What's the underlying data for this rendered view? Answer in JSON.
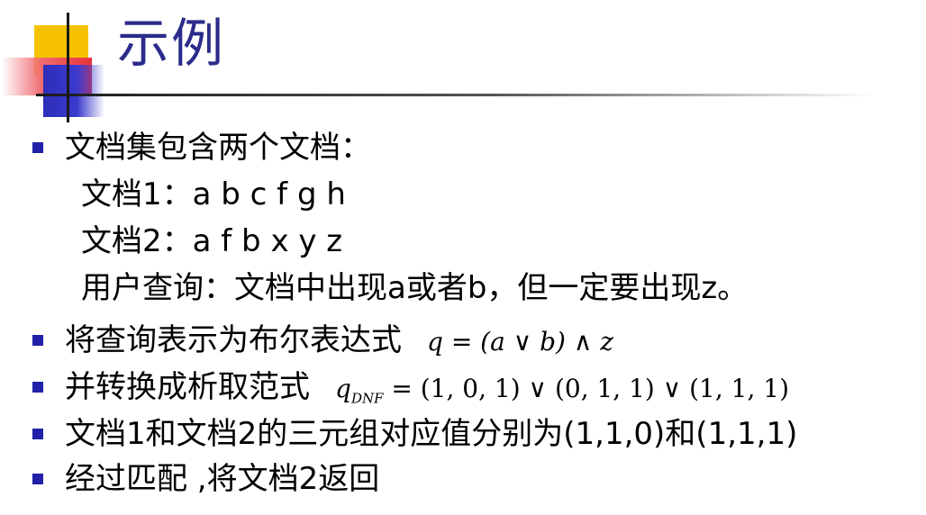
{
  "title": "示例",
  "bullets": [
    "文档集包含两个文档：",
    "将查询表示为布尔表达式",
    "并转换成析取范式",
    "文档1和文档2的三元组对应值分别为(1,1,0)和(1,1,1)",
    "经过匹配 ,将文档2返回"
  ],
  "sub_lines": [
    "文档1：a b c f g h",
    "文档2：a f b x y z",
    "用户查询：文档中出现a或者b，但一定要出现z。"
  ],
  "formulas": {
    "boolean_query": "q = (a ∨ b) ∧ z",
    "dnf_q": "q",
    "dnf_sub": "DNF",
    "dnf_rest": " = (1, 0, 1) ∨ (0, 1, 1) ∨ (1, 1, 1)"
  },
  "colors": {
    "title": "#2b2b8c",
    "bullet": "#2020a8",
    "accent_yellow": "#f6c200",
    "accent_red": "#e8323a",
    "accent_blue": "#2e2eb8"
  }
}
